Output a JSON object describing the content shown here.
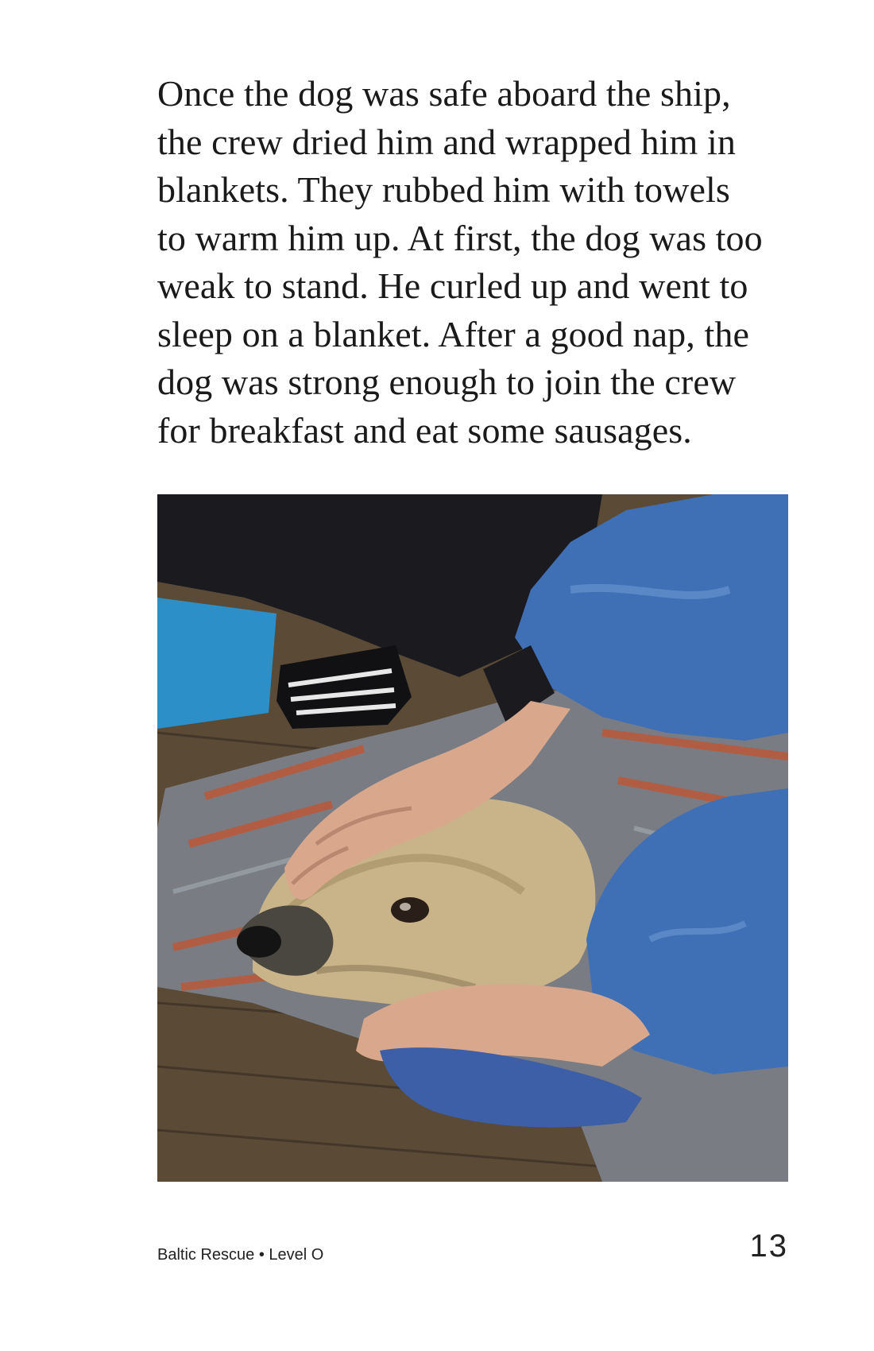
{
  "page": {
    "story_lines": [
      "Once the dog was safe aboard the ship,",
      "the crew dried him and wrapped him in",
      "blankets. They rubbed him with towels",
      "to warm him up. At first, the dog was too",
      "weak to stand. He curled up and went to",
      "sleep on a blanket. After a good nap, the",
      "dog was strong enough to join the crew",
      "for breakfast and eat some sausages."
    ],
    "photo": {
      "colors": {
        "floor": "#5a4a36",
        "floor_dark": "#3b3025",
        "blanket_gray": "#7a7c84",
        "blanket_red": "#b85a3c",
        "sleeve_blue": "#3f6fb5",
        "towel_blue": "#3d5fa8",
        "dog_fur": "#c9b48a",
        "skin": "#d9a88c",
        "black_clothing": "#1b1b1f",
        "bin_blue": "#2d8fc7"
      }
    },
    "footer": {
      "book_title": "Baltic Rescue • Level O",
      "page_number": "13"
    }
  }
}
